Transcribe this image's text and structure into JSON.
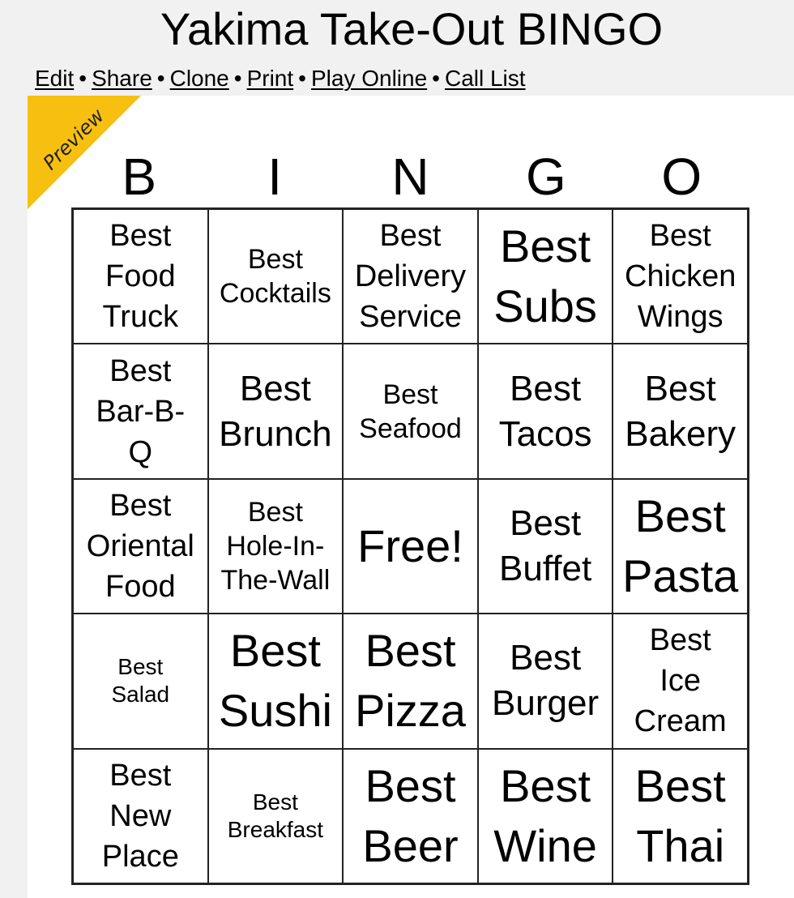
{
  "page": {
    "title": "Yakima Take-Out BINGO"
  },
  "nav": {
    "links": [
      "Edit",
      "Share",
      "Clone",
      "Print",
      "Play Online",
      "Call List"
    ],
    "separator": "•"
  },
  "card": {
    "ribbon_label": "Preview",
    "ribbon_color": "#f7c010",
    "header_letters": [
      "B",
      "I",
      "N",
      "G",
      "O"
    ],
    "cells": [
      [
        "Best\nFood\nTruck",
        "Best\nCocktails",
        "Best\nDelivery\nService",
        "Best\nSubs",
        "Best\nChicken\nWings"
      ],
      [
        "Best\nBar-B-\nQ",
        "Best\nBrunch",
        "Best\nSeafood",
        "Best\nTacos",
        "Best\nBakery"
      ],
      [
        "Best\nOriental\nFood",
        "Best\nHole-In-\nThe-Wall",
        "Free!",
        "Best\nBuffet",
        "Best\nPasta"
      ],
      [
        "Best\nSalad",
        "Best\nSushi",
        "Best\nPizza",
        "Best\nBurger",
        "Best\nIce\nCream"
      ],
      [
        "Best\nNew\nPlace",
        "Best\nBreakfast",
        "Best\nBeer",
        "Best\nWine",
        "Best\nThai"
      ]
    ]
  }
}
